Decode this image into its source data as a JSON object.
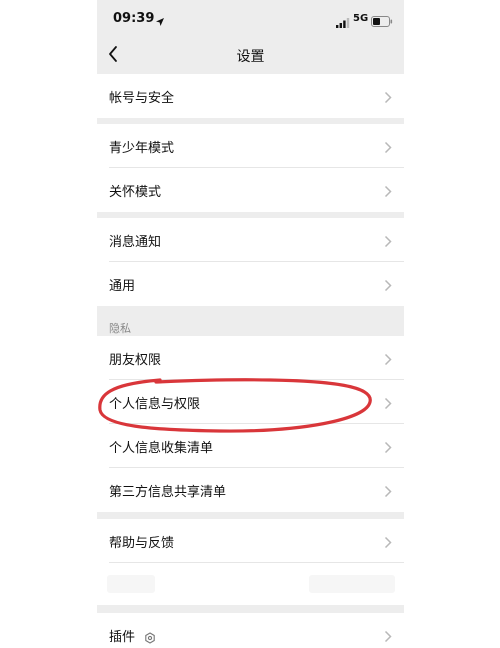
{
  "status_bar": {
    "time": "09:39",
    "network": "5G"
  },
  "nav": {
    "title": "设置"
  },
  "groups": {
    "account": [
      "帐号与安全"
    ],
    "modes": [
      "青少年模式",
      "关怀模式"
    ],
    "general": [
      "消息通知",
      "通用"
    ],
    "privacy": {
      "header": "隐私",
      "items": [
        "朋友权限",
        "个人信息与权限",
        "个人信息收集清单",
        "第三方信息共享清单"
      ]
    },
    "help": [
      "帮助与反馈"
    ],
    "plugins": [
      "插件"
    ]
  },
  "icons": {
    "location": "location-arrow-icon",
    "signal": "signal-bars-icon",
    "battery": "battery-icon",
    "back": "back-chevron-icon",
    "row_chevron": "chevron-right-icon",
    "plugin": "plugin-icon"
  },
  "annotation": {
    "color": "#d9363a",
    "target": "个人信息与权限"
  }
}
